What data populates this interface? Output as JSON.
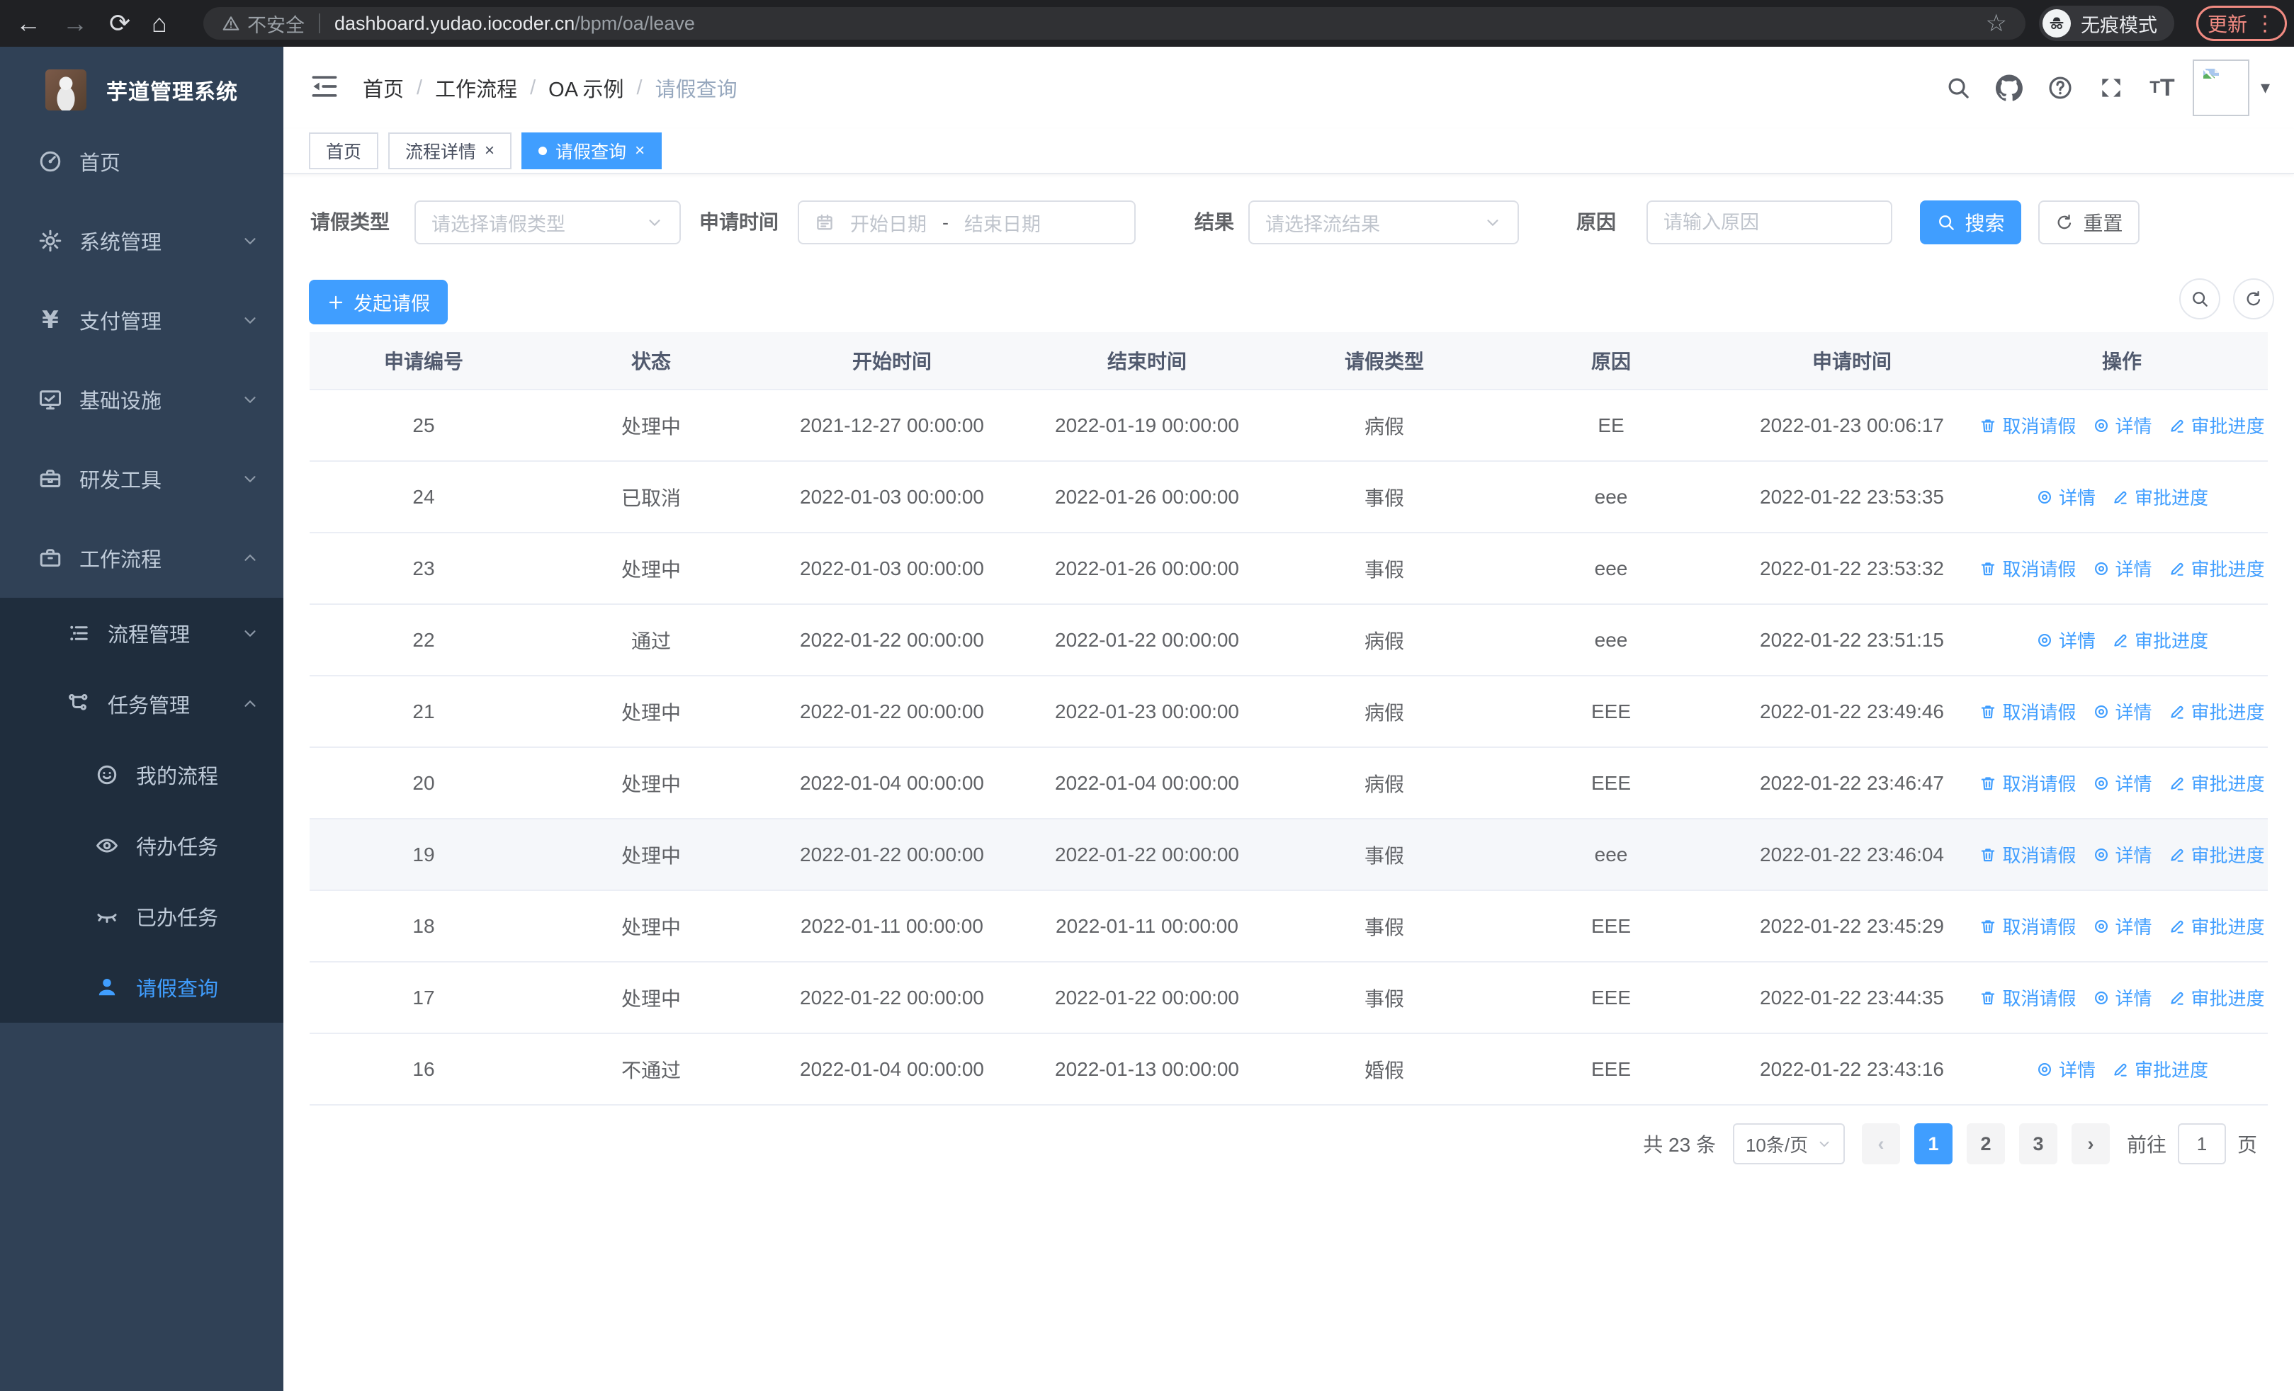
{
  "browser": {
    "security_label": "不安全",
    "url_host": "dashboard.yudao.iocoder.cn",
    "url_path": "/bpm/oa/leave",
    "incognito_label": "无痕模式",
    "update_label": "更新",
    "back_icon": "←",
    "forward_icon": "→",
    "reload_icon": "⟳",
    "home_icon": "⌂",
    "star_icon": "☆",
    "menu_dots_icon": "⋮"
  },
  "sidebar": {
    "title": "芋道管理系统",
    "menu": [
      {
        "key": "home",
        "label": "首页",
        "icon": "dashboard-icon",
        "level": 1
      },
      {
        "key": "system",
        "label": "系统管理",
        "icon": "gear-icon",
        "level": 1,
        "chevron": "down"
      },
      {
        "key": "payment",
        "label": "支付管理",
        "icon": "yen-icon",
        "level": 1,
        "chevron": "down"
      },
      {
        "key": "infra",
        "label": "基础设施",
        "icon": "monitor-icon",
        "level": 1,
        "chevron": "down"
      },
      {
        "key": "devtools",
        "label": "研发工具",
        "icon": "toolbox-icon",
        "level": 1,
        "chevron": "down"
      },
      {
        "key": "workflow",
        "label": "工作流程",
        "icon": "briefcase-icon",
        "level": 1,
        "chevron": "up"
      },
      {
        "key": "process-mgmt",
        "label": "流程管理",
        "icon": "list-icon",
        "level": 2,
        "chevron": "down"
      },
      {
        "key": "task-mgmt",
        "label": "任务管理",
        "icon": "flow-icon",
        "level": 2,
        "chevron": "up"
      },
      {
        "key": "my-process",
        "label": "我的流程",
        "icon": "face-icon",
        "level": 3
      },
      {
        "key": "todo-task",
        "label": "待办任务",
        "icon": "eye-open-icon",
        "level": 3
      },
      {
        "key": "done-task",
        "label": "已办任务",
        "icon": "eye-closed-icon",
        "level": 3
      },
      {
        "key": "leave-query",
        "label": "请假查询",
        "icon": "user-icon",
        "level": 3,
        "active": true
      }
    ]
  },
  "navbar": {
    "separator": "/",
    "breadcrumb": [
      {
        "label": "首页"
      },
      {
        "label": "工作流程"
      },
      {
        "label": "OA 示例"
      },
      {
        "label": "请假查询",
        "muted": true
      }
    ],
    "right_icons": [
      "search-icon",
      "github-icon",
      "help-icon",
      "fullscreen-icon",
      "fontsize-icon"
    ],
    "caret_icon": "▾"
  },
  "tabs": [
    {
      "label": "首页"
    },
    {
      "label": "流程详情",
      "closable": true
    },
    {
      "label": "请假查询",
      "closable": true,
      "active": true
    }
  ],
  "close_glyph": "×",
  "filters": {
    "leave_type_label": "请假类型",
    "leave_type_placeholder": "请选择请假类型",
    "apply_time_label": "申请时间",
    "start_placeholder": "开始日期",
    "range_separator": "-",
    "end_placeholder": "结束日期",
    "result_label": "结果",
    "result_placeholder": "请选择流结果",
    "reason_label": "原因",
    "reason_placeholder": "请输入原因",
    "search_label": "搜索",
    "reset_label": "重置"
  },
  "toolbar": {
    "create_label": "发起请假"
  },
  "table": {
    "columns": [
      "申请编号",
      "状态",
      "开始时间",
      "结束时间",
      "请假类型",
      "原因",
      "申请时间",
      "操作"
    ],
    "action_labels": {
      "cancel": "取消请假",
      "detail": "详情",
      "progress": "审批进度"
    },
    "rows": [
      {
        "id": "25",
        "status": "处理中",
        "start": "2021-12-27 00:00:00",
        "end": "2022-01-19 00:00:00",
        "type": "病假",
        "reason": "EE",
        "applied": "2022-01-23 00:06:17",
        "actions": [
          "cancel",
          "detail",
          "progress"
        ]
      },
      {
        "id": "24",
        "status": "已取消",
        "start": "2022-01-03 00:00:00",
        "end": "2022-01-26 00:00:00",
        "type": "事假",
        "reason": "eee",
        "applied": "2022-01-22 23:53:35",
        "actions": [
          "detail",
          "progress"
        ]
      },
      {
        "id": "23",
        "status": "处理中",
        "start": "2022-01-03 00:00:00",
        "end": "2022-01-26 00:00:00",
        "type": "事假",
        "reason": "eee",
        "applied": "2022-01-22 23:53:32",
        "actions": [
          "cancel",
          "detail",
          "progress"
        ]
      },
      {
        "id": "22",
        "status": "通过",
        "start": "2022-01-22 00:00:00",
        "end": "2022-01-22 00:00:00",
        "type": "病假",
        "reason": "eee",
        "applied": "2022-01-22 23:51:15",
        "actions": [
          "detail",
          "progress"
        ]
      },
      {
        "id": "21",
        "status": "处理中",
        "start": "2022-01-22 00:00:00",
        "end": "2022-01-23 00:00:00",
        "type": "病假",
        "reason": "EEE",
        "applied": "2022-01-22 23:49:46",
        "actions": [
          "cancel",
          "detail",
          "progress"
        ]
      },
      {
        "id": "20",
        "status": "处理中",
        "start": "2022-01-04 00:00:00",
        "end": "2022-01-04 00:00:00",
        "type": "病假",
        "reason": "EEE",
        "applied": "2022-01-22 23:46:47",
        "actions": [
          "cancel",
          "detail",
          "progress"
        ]
      },
      {
        "id": "19",
        "status": "处理中",
        "start": "2022-01-22 00:00:00",
        "end": "2022-01-22 00:00:00",
        "type": "事假",
        "reason": "eee",
        "applied": "2022-01-22 23:46:04",
        "actions": [
          "cancel",
          "detail",
          "progress"
        ],
        "highlighted": true
      },
      {
        "id": "18",
        "status": "处理中",
        "start": "2022-01-11 00:00:00",
        "end": "2022-01-11 00:00:00",
        "type": "事假",
        "reason": "EEE",
        "applied": "2022-01-22 23:45:29",
        "actions": [
          "cancel",
          "detail",
          "progress"
        ]
      },
      {
        "id": "17",
        "status": "处理中",
        "start": "2022-01-22 00:00:00",
        "end": "2022-01-22 00:00:00",
        "type": "事假",
        "reason": "EEE",
        "applied": "2022-01-22 23:44:35",
        "actions": [
          "cancel",
          "detail",
          "progress"
        ]
      },
      {
        "id": "16",
        "status": "不通过",
        "start": "2022-01-04 00:00:00",
        "end": "2022-01-13 00:00:00",
        "type": "婚假",
        "reason": "EEE",
        "applied": "2022-01-22 23:43:16",
        "actions": [
          "detail",
          "progress"
        ]
      }
    ]
  },
  "pagination": {
    "total_label": "共 23 条",
    "page_size": "10条/页",
    "pages": [
      "1",
      "2",
      "3"
    ],
    "current": "1",
    "prev_icon": "‹",
    "next_icon": "›",
    "goto_label": "前往",
    "goto_value": "1",
    "page_unit": "页"
  },
  "colors": {
    "accent": "#409eff",
    "sidebar_bg": "#304156",
    "submenu_bg": "#1f2d3d",
    "update_badge": "#f28b82"
  }
}
